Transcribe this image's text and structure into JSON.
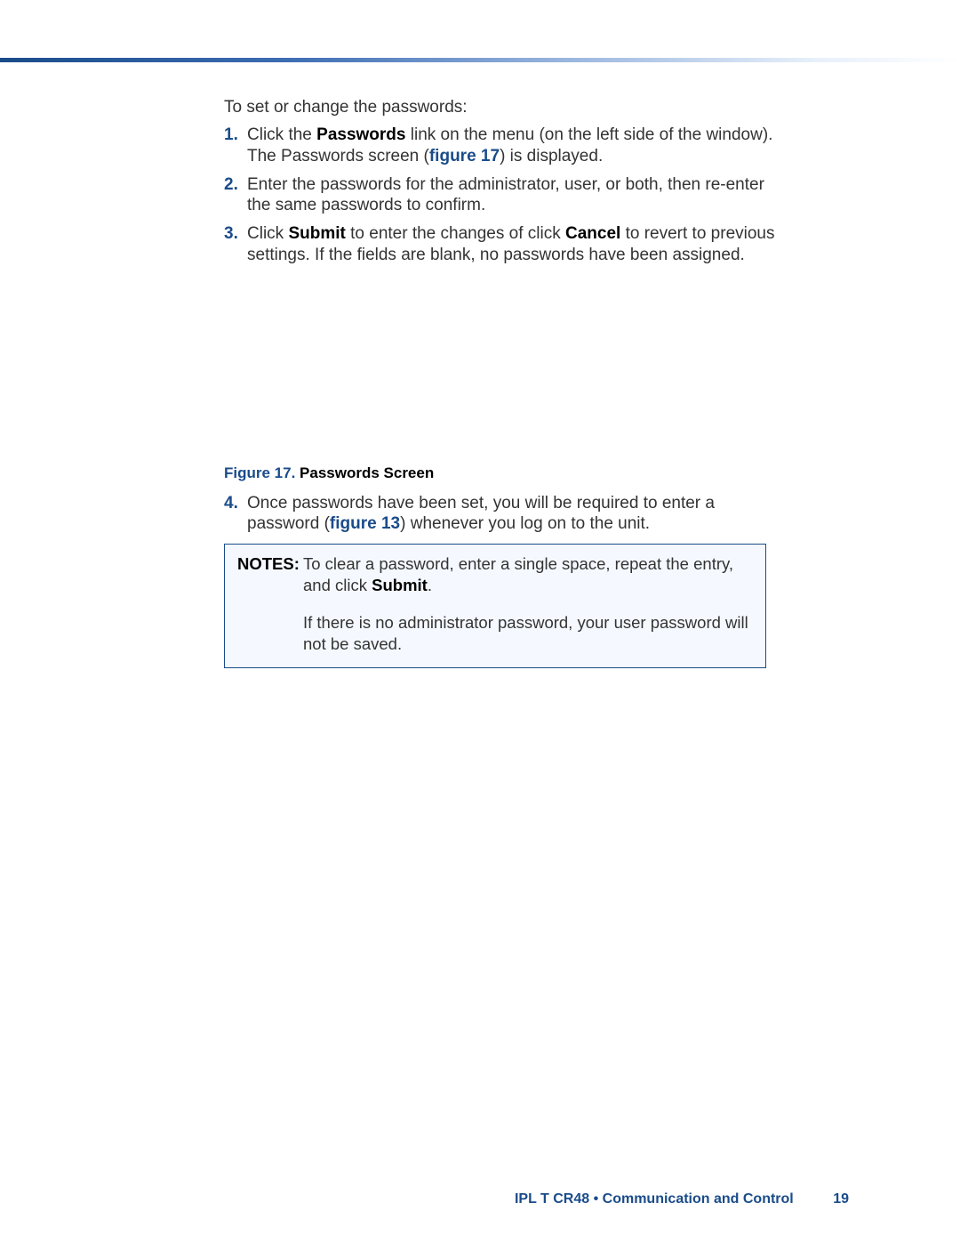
{
  "intro": "To set or change the passwords:",
  "steps": [
    {
      "num": "1.",
      "parts": [
        {
          "t": "Click the ",
          "style": "normal"
        },
        {
          "t": "Passwords",
          "style": "bold"
        },
        {
          "t": " link on the menu (on the left side of the window). The Passwords screen (",
          "style": "normal"
        },
        {
          "t": "figure 17",
          "style": "link"
        },
        {
          "t": ") is displayed.",
          "style": "normal"
        }
      ]
    },
    {
      "num": "2.",
      "parts": [
        {
          "t": "Enter the passwords for the administrator, user, or both, then re-enter the same passwords to confirm.",
          "style": "normal"
        }
      ]
    },
    {
      "num": "3.",
      "parts": [
        {
          "t": "Click ",
          "style": "normal"
        },
        {
          "t": "Submit",
          "style": "bold"
        },
        {
          "t": " to enter the changes of click ",
          "style": "normal"
        },
        {
          "t": "Cancel",
          "style": "bold"
        },
        {
          "t": " to revert to previous settings. If the fields are blank, no passwords have been assigned.",
          "style": "normal"
        }
      ]
    }
  ],
  "figure": {
    "label": "Figure 17.",
    "title": " Passwords Screen"
  },
  "step4": {
    "num": "4.",
    "parts": [
      {
        "t": "Once passwords have been set, you will be required to enter a password (",
        "style": "normal"
      },
      {
        "t": "figure 13",
        "style": "link"
      },
      {
        "t": ") whenever you log on to the unit.",
        "style": "normal"
      }
    ]
  },
  "notes": {
    "label": "NOTES:",
    "note1_parts": [
      {
        "t": "To clear a password, enter a single space, repeat the entry, and click ",
        "style": "normal"
      },
      {
        "t": "Submit",
        "style": "bold"
      },
      {
        "t": ".",
        "style": "normal"
      }
    ],
    "note2": "If there is no administrator password, your user password will not be saved."
  },
  "footer": {
    "title": "IPL T CR48 • Communication and Control",
    "page": "19"
  }
}
